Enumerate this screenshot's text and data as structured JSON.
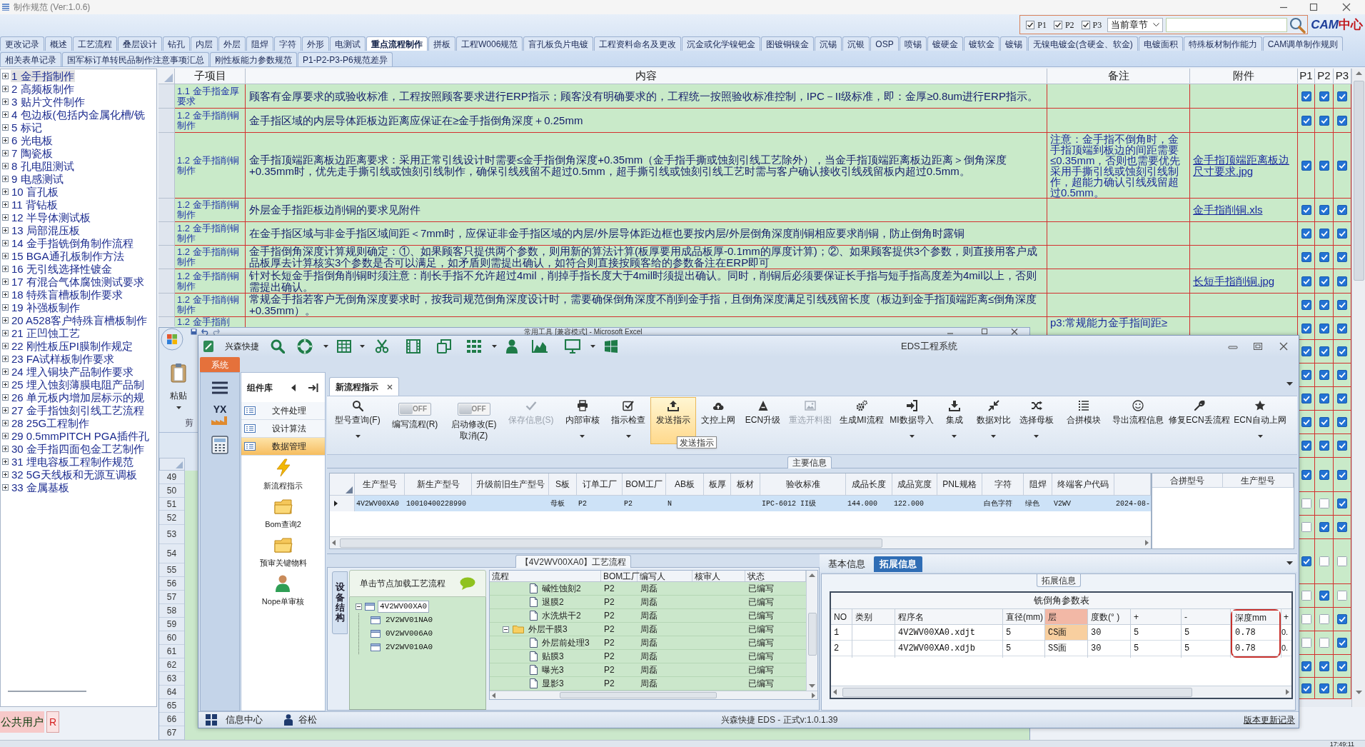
{
  "main_window": {
    "title": "制作规范 (Ver:1.0.6)"
  },
  "search_panel": {
    "filters": [
      {
        "label": "P1",
        "checked": true
      },
      {
        "label": "P2",
        "checked": true
      },
      {
        "label": "P3",
        "checked": true
      }
    ],
    "scope": "当前章节",
    "logo_latin": "CAM",
    "logo_cjk": "中心"
  },
  "tab_rows": [
    [
      {
        "label": "更改记录",
        "selected": false
      },
      {
        "label": "概述",
        "selected": false
      },
      {
        "label": "工艺流程",
        "selected": false
      },
      {
        "label": "叠层设计",
        "selected": false
      },
      {
        "label": "钻孔",
        "selected": false
      },
      {
        "label": "内层",
        "selected": false
      },
      {
        "label": "外层",
        "selected": false
      },
      {
        "label": "阻焊",
        "selected": false
      },
      {
        "label": "字符",
        "selected": false
      },
      {
        "label": "外形",
        "selected": false
      },
      {
        "label": "电测试",
        "selected": false
      },
      {
        "label": "重点流程制作",
        "selected": true
      },
      {
        "label": "拼板",
        "selected": false
      },
      {
        "label": "工程W006规范",
        "selected": false
      },
      {
        "label": "盲孔板负片电镀",
        "selected": false
      },
      {
        "label": "工程资料命名及更改",
        "selected": false
      },
      {
        "label": "沉金或化学镍钯金",
        "selected": false
      },
      {
        "label": "图镀铜镍金",
        "selected": false
      },
      {
        "label": "沉锡",
        "selected": false
      },
      {
        "label": "沉银",
        "selected": false
      },
      {
        "label": "OSP",
        "selected": false
      },
      {
        "label": "喷锡",
        "selected": false
      },
      {
        "label": "镀硬金",
        "selected": false
      },
      {
        "label": "镀软金",
        "selected": false
      },
      {
        "label": "镀锡",
        "selected": false
      },
      {
        "label": "无镍电镀金(含硬金、软金)",
        "selected": false
      },
      {
        "label": "电镀面积",
        "selected": false
      },
      {
        "label": "特殊板材制作能力",
        "selected": false
      },
      {
        "label": "CAM调单制作规则",
        "selected": false
      }
    ],
    [
      {
        "label": "相关表单记录",
        "selected": false
      },
      {
        "label": "国军标订单转民品制作注意事项汇总",
        "selected": false
      },
      {
        "label": "刚性板能力参数规范",
        "selected": false
      },
      {
        "label": "P1-P2-P3-P6规范差异",
        "selected": false
      }
    ]
  ],
  "chapter_tree": {
    "items": [
      {
        "label": "1 金手指制作",
        "selected": true,
        "expanded": false
      },
      {
        "label": "2 高频板制作",
        "selected": false,
        "expanded": false
      },
      {
        "label": "3 贴片文件制作",
        "selected": false,
        "expanded": false
      },
      {
        "label": "4 包边板(包括内金属化槽/铣",
        "selected": false,
        "expanded": false
      },
      {
        "label": "5 标记",
        "selected": false,
        "expanded": false
      },
      {
        "label": "6 光电板",
        "selected": false,
        "expanded": false
      },
      {
        "label": "7 陶瓷板",
        "selected": false,
        "expanded": false
      },
      {
        "label": "8 孔电阻测试",
        "selected": false,
        "expanded": false
      },
      {
        "label": "9 电感测试",
        "selected": false,
        "expanded": false
      },
      {
        "label": "10 盲孔板",
        "selected": false,
        "expanded": false
      },
      {
        "label": "11 背钻板",
        "selected": false,
        "expanded": false
      },
      {
        "label": "12 半导体测试板",
        "selected": false,
        "expanded": false
      },
      {
        "label": "13 局部混压板",
        "selected": false,
        "expanded": false
      },
      {
        "label": "14 金手指铣倒角制作流程",
        "selected": false,
        "expanded": false
      },
      {
        "label": "15 BGA通孔板制作方法",
        "selected": false,
        "expanded": false
      },
      {
        "label": "16 无引线选择性镀金",
        "selected": false,
        "expanded": false
      },
      {
        "label": "17 有混合气体腐蚀测试要求",
        "selected": false,
        "expanded": false
      },
      {
        "label": "18 特殊盲槽板制作要求",
        "selected": false,
        "expanded": false
      },
      {
        "label": "19 补强板制作",
        "selected": false,
        "expanded": false
      },
      {
        "label": "20 A528客户特殊盲槽板制作",
        "selected": false,
        "expanded": false
      },
      {
        "label": "21 正凹蚀工艺",
        "selected": false,
        "expanded": false
      },
      {
        "label": "22 刚性板压PI膜制作规定",
        "selected": false,
        "expanded": false
      },
      {
        "label": "23 FA试样板制作要求",
        "selected": false,
        "expanded": false
      },
      {
        "label": "24 埋入铜块产品制作要求",
        "selected": false,
        "expanded": false
      },
      {
        "label": "25 埋入蚀刻薄膜电阻产品制",
        "selected": false,
        "expanded": false
      },
      {
        "label": "26 单元板内增加层标示的规",
        "selected": false,
        "expanded": false
      },
      {
        "label": "27 金手指蚀刻引线工艺流程",
        "selected": false,
        "expanded": false
      },
      {
        "label": "28 25G工程制作",
        "selected": false,
        "expanded": false
      },
      {
        "label": "29 0.5mmPITCH PGA插件孔",
        "selected": false,
        "expanded": false
      },
      {
        "label": "30 金手指四面包金工艺制作",
        "selected": false,
        "expanded": false
      },
      {
        "label": "31 埋电容板工程制作规范",
        "selected": false,
        "expanded": false
      },
      {
        "label": "32 5G天线板和无源互调板",
        "selected": false,
        "expanded": false
      },
      {
        "label": "33 金属基板",
        "selected": false,
        "expanded": false
      }
    ]
  },
  "user": {
    "name": "公共用户",
    "badge": "R"
  },
  "rules_table": {
    "columns": [
      "子项目",
      "内容",
      "备注",
      "附件",
      "P1",
      "P2",
      "P3"
    ],
    "rows": [
      {
        "subitem": "1.1 金手指金厚要求",
        "content": "顾客有金厚要求的或验收标准，工程按照顾客要求进行ERP指示；顾客没有明确要求的，工程统一按照验收标准控制，IPC－II级标准，即：金厚≥0.8um进行ERP指示。",
        "p1": true,
        "p2": true,
        "p3": true
      },
      {
        "subitem": "1.2 金手指削铜制作",
        "content": "金手指区域的内层导体距板边距离应保证在≥金手指倒角深度＋0.25mm",
        "p1": true,
        "p2": true,
        "p3": true
      },
      {
        "subitem": "1.2 金手指削铜制作",
        "content": "金手指顶端距离板边距离要求：采用正常引线设计时需要≤金手指倒角深度+0.35mm（金手指手撕或蚀刻引线工艺除外），当金手指顶端距离板边距离＞倒角深度+0.35mm时，优先走手撕引线或蚀刻引线制作，确保引线残留不超过0.5mm，超手撕引线或蚀刻引线工艺时需与客户确认接收引线残留板内超过0.5mm。",
        "remark": "注意：金手指不倒角时，金手指顶端到板边的间距需要≤0.35mm，否则也需要优先采用手撕引线或蚀刻引线制作，超能力确认引线残留超过0.5mm。",
        "attachment": "金手指顶端距离板边尺寸要求.jpg",
        "p1": true,
        "p2": true,
        "p3": true
      },
      {
        "subitem": "1.2 金手指削铜制作",
        "content": "外层金手指距板边削铜的要求见附件",
        "attachment": "金手指削铜.xls",
        "p1": true,
        "p2": true,
        "p3": true
      },
      {
        "subitem": "1.2 金手指削铜制作",
        "content": "在金手指区域与非金手指区域间距＜7mm时，应保证非金手指区域的内层/外层导体距边框也要按内层/外层倒角深度削铜相应要求削铜，防止倒角时露铜",
        "p1": true,
        "p2": true,
        "p3": true
      },
      {
        "subitem": "1.2 金手指削铜制作",
        "content": "金手指倒角深度计算规则确定：①、如果顾客只提供两个参数，则用新的算法计算(板厚要用成品板厚-0.1mm的厚度计算)；②、如果顾客提供3个参数，则直接用客户成品板厚去计算核实3个参数是否可以满足，如矛盾则需提出确认，如符合则直接按顾客给的参数备注在ERP即可",
        "p1": true,
        "p2": true,
        "p3": true
      },
      {
        "subitem": "1.2 金手指削铜制作",
        "content": "针对长短金手指倒角削铜时须注意：削长手指不允许超过4mil，削掉手指长度大于4mil时须提出确认。同时，削铜后必须要保证长手指与短手指高度差为4mil以上，否则需提出确认。",
        "attachment": "长短手指削铜.jpg",
        "p1": true,
        "p2": true,
        "p3": true
      },
      {
        "subitem": "1.2 金手指削铜制作",
        "content": "常规金手指若客户无倒角深度要求时，按我司规范倒角深度设计时，需要确保倒角深度不削到金手指，且倒角深度满足引线残留长度（板边到金手指顶端距离≤倒角深度+0.35mm）。",
        "p1": true,
        "p2": true,
        "p3": true
      },
      {
        "subitem": "1.2 金手指削",
        "remark": "p3:常规能力金手指间距≥",
        "p1": true,
        "p2": true,
        "p3": true
      },
      {
        "p1": true,
        "p2": true,
        "p3": true
      },
      {
        "p1": true,
        "p2": true,
        "p3": true
      },
      {
        "p1": true,
        "p2": true,
        "p3": true
      },
      {
        "p1": true,
        "p2": true,
        "p3": true
      },
      {
        "p1": true,
        "p2": true,
        "p3": true
      },
      {
        "p1": true,
        "p2": true,
        "p3": true
      },
      {
        "p1": false,
        "p2": false,
        "p3": true
      },
      {
        "p1": false,
        "p2": true,
        "p3": true
      },
      {
        "p1": true,
        "p2": false,
        "p3": false
      },
      {
        "p1": false,
        "p2": true,
        "p3": false
      },
      {
        "p1": false,
        "p2": false,
        "p3": true
      },
      {
        "p1": false,
        "p2": false,
        "p3": true
      },
      {
        "p1": true,
        "p2": true,
        "p3": true
      },
      {
        "p1": true,
        "p2": true,
        "p3": true
      }
    ]
  },
  "excel_window": {
    "title": "常用工具 [兼容模式] - Microsoft Excel",
    "paste_label": "粘贴",
    "group_label": "剪",
    "row_numbers": [
      "49",
      "50",
      "51",
      "52",
      "53",
      "54",
      "55",
      "56",
      "57",
      "58",
      "59",
      "60",
      "61",
      "62",
      "63",
      "64",
      "65",
      "66",
      "67"
    ]
  },
  "eds_window": {
    "title": "EDS工程系统",
    "app_name": "兴森快捷",
    "menu_tab": "系统",
    "nav_badge": "YX",
    "library": {
      "title": "组件库",
      "categories": [
        {
          "label": "文件处理",
          "selected": false
        },
        {
          "label": "设计算法",
          "selected": false
        },
        {
          "label": "数据管理",
          "selected": true
        }
      ],
      "components": [
        "新流程指示",
        "Bom查询2",
        "预审关键物料",
        "Nope单审核"
      ]
    },
    "document_tab": "新流程指示",
    "ribbon": [
      {
        "kind": "button",
        "label": "型号查询(F)",
        "disabled": false,
        "highlighted": false,
        "dropdown": true
      },
      {
        "kind": "toggle",
        "toggle_text": "OFF",
        "on": false,
        "label": "编写流程(R)",
        "disabled": false,
        "highlighted": false,
        "dropdown": false
      },
      {
        "kind": "toggle",
        "toggle_text": "OFF",
        "on": false,
        "label": "启动修改(E)",
        "sublabel": "取消(Z)",
        "disabled": false,
        "highlighted": false,
        "dropdown": false
      },
      {
        "kind": "button",
        "label": "保存信息(S)",
        "disabled": true,
        "highlighted": false,
        "dropdown": false
      },
      {
        "kind": "button",
        "label": "内部审核",
        "disabled": false,
        "highlighted": false,
        "dropdown": true
      },
      {
        "kind": "button",
        "label": "指示检查",
        "disabled": false,
        "highlighted": false,
        "dropdown": true
      },
      {
        "kind": "button",
        "label": "发送指示",
        "disabled": false,
        "highlighted": true,
        "dropdown": false
      },
      {
        "kind": "button",
        "label": "文控上网",
        "disabled": false,
        "highlighted": false,
        "dropdown": false
      },
      {
        "kind": "button",
        "label": "ECN升级",
        "disabled": false,
        "highlighted": false,
        "dropdown": false
      },
      {
        "kind": "button",
        "label": "重选开料图",
        "disabled": true,
        "highlighted": false,
        "dropdown": false
      },
      {
        "kind": "button",
        "label": "生成MI流程",
        "disabled": false,
        "highlighted": false,
        "dropdown": false
      },
      {
        "kind": "button",
        "label": "MI数据导入",
        "disabled": false,
        "highlighted": false,
        "dropdown": true
      },
      {
        "kind": "button",
        "label": "集成",
        "disabled": false,
        "highlighted": false,
        "dropdown": true
      },
      {
        "kind": "button",
        "label": "数据对比",
        "disabled": false,
        "highlighted": false,
        "dropdown": true
      },
      {
        "kind": "button",
        "label": "选择母板",
        "disabled": false,
        "highlighted": false,
        "dropdown": true
      },
      {
        "kind": "button",
        "label": "合拼模块",
        "disabled": false,
        "highlighted": false,
        "dropdown": false
      },
      {
        "kind": "button",
        "label": "导出流程信息",
        "disabled": false,
        "highlighted": false,
        "dropdown": false
      },
      {
        "kind": "button",
        "label": "修复ECN丢流程",
        "disabled": false,
        "highlighted": false,
        "dropdown": false
      },
      {
        "kind": "button",
        "label": "ECN自动上网",
        "disabled": false,
        "highlighted": false,
        "dropdown": true
      }
    ],
    "tooltip": "发送指示",
    "main_info": {
      "title": "主要信息",
      "columns": [
        "生产型号",
        "新生产型号",
        "升级前旧生产型号",
        "S板",
        "订单工厂",
        "BOM工厂",
        "AB板",
        "板厚",
        "板材",
        "验收标准",
        "成品长度",
        "成品宽度",
        "PNL规格",
        "字符",
        "阻焊",
        "终端客户代码"
      ],
      "rows": [
        {
          "selected": true,
          "current": true,
          "cells": [
            "4V2WV00XA0",
            "10010400228990",
            null,
            "母板",
            "P2",
            "P2",
            "N",
            null,
            null,
            "IPC-6012 II级",
            "144.000",
            "122.000",
            null,
            "白色字符",
            "绿色",
            "V2WV",
            "2024-08-"
          ]
        }
      ],
      "side_columns": [
        "合拼型号",
        "生产型号"
      ]
    },
    "process_panel": {
      "title": "【4V2WV00XA0】工艺流程",
      "side_tab": "设备结构",
      "tree_hint": "单击节点加载工艺流程",
      "tree": [
        {
          "label": "4V2WV00XA0",
          "selected": true,
          "expanded": true,
          "children": [
            {
              "label": "2V2WV01NA0",
              "selected": false
            },
            {
              "label": "0V2WV006A0",
              "selected": false
            },
            {
              "label": "2V2WV010A0",
              "selected": false
            }
          ]
        }
      ],
      "columns": [
        "流程",
        "BOM工厂",
        "编写人",
        "核审人",
        "状态"
      ],
      "continued_rows": [
        {
          "step": "碱性蚀刻2",
          "bom_factory": "P2",
          "writer": "周磊",
          "status": "已编写"
        },
        {
          "step": "退膜2",
          "bom_factory": "P2",
          "writer": "周磊",
          "status": "已编写"
        },
        {
          "step": "水洗烘干2",
          "bom_factory": "P2",
          "writer": "周磊",
          "status": "已编写"
        }
      ],
      "nodes": [
        {
          "step": "外层干膜3",
          "bom_factory": "P2",
          "writer": "周磊",
          "status": "已编写",
          "expanded": true,
          "children": [
            {
              "step": "外层前处理3",
              "bom_factory": "P2",
              "writer": "周磊",
              "status": "已编写"
            },
            {
              "step": "贴膜3",
              "bom_factory": "P2",
              "writer": "周磊",
              "status": "已编写"
            },
            {
              "step": "曝光3",
              "bom_factory": "P2",
              "writer": "周磊",
              "status": "已编写"
            },
            {
              "step": "显影3",
              "bom_factory": "P2",
              "writer": "周磊",
              "status": "已编写"
            }
          ]
        }
      ]
    },
    "detail_panel": {
      "tabs": [
        {
          "label": "基本信息",
          "selected": false
        },
        {
          "label": "拓展信息",
          "selected": true
        }
      ],
      "group_title": "拓展信息",
      "table": {
        "title": "铣倒角参数表",
        "columns": [
          {
            "label": "NO",
            "selected": false
          },
          {
            "label": "类别",
            "selected": false
          },
          {
            "label": "程序名",
            "selected": false
          },
          {
            "label": "直径(mm)",
            "selected": false
          },
          {
            "label": "层",
            "selected": true
          },
          {
            "label": "度数(° )",
            "selected": false
          },
          {
            "label": "+",
            "selected": false
          },
          {
            "label": "-",
            "selected": false
          },
          {
            "label": "深度mm",
            "selected": false
          },
          {
            "label": "+",
            "selected": false
          }
        ],
        "rows": [
          {
            "selected": true,
            "cells": [
              "1",
              null,
              "4V2WV00XA0.xdjt",
              "5",
              "CS面",
              "30",
              "5",
              "5",
              "0.78",
              "0."
            ]
          },
          {
            "selected": false,
            "cells": [
              "2",
              null,
              "4V2WV00XA0.xdjb",
              "5",
              "SS面",
              "30",
              "5",
              "5",
              "0.78",
              "0."
            ]
          }
        ]
      }
    },
    "status_bar": {
      "items": [
        "信息中心",
        "谷松"
      ],
      "version": "兴森快捷 EDS - 正式v:1.0.1.39",
      "link": "版本更新记录"
    }
  },
  "taskbar": {
    "clock": "17:49:11"
  }
}
